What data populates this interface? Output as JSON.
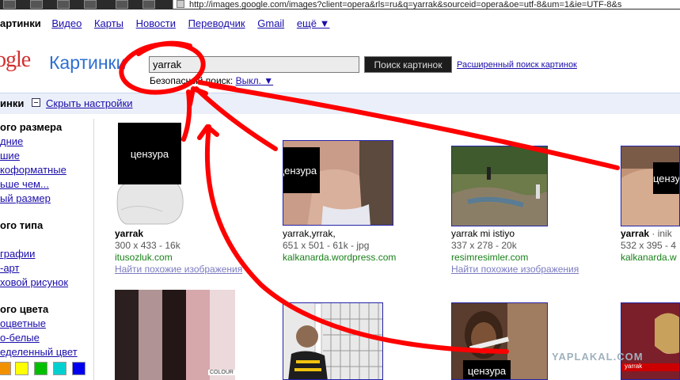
{
  "browser": {
    "url": "http://images.google.com/images?client=opera&rls=ru&q=yarrak&sourceid=opera&oe=utf-8&um=1&ie=UTF-8&s"
  },
  "nav": {
    "current": "артинки",
    "links": [
      "Видео",
      "Карты",
      "Новости",
      "Переводчик",
      "Gmail"
    ],
    "more": "ещё ▼"
  },
  "header": {
    "logo": "ogle",
    "product": "Картинки",
    "search_value": "yarrak",
    "search_button": "Поиск картинок",
    "advanced": "Расширенный поиск картинок",
    "safe_label": "Безопасный поиск:",
    "safe_value": "Выкл. ▼"
  },
  "settings": {
    "label": "инки",
    "hide": "Скрыть настройки"
  },
  "sidebar": {
    "size": {
      "title": "ого размера",
      "items": [
        "дние",
        "шие",
        "коформатные",
        "ьше чем...",
        "ый размер"
      ]
    },
    "type": {
      "title": "ого типа",
      "items": [
        "",
        "графии",
        "-арт",
        "ховой рисунок"
      ]
    },
    "color": {
      "title": "ого цвета",
      "items": [
        "оцветные",
        "о-белые",
        "еделенный цвет"
      ]
    },
    "swatches": [
      "#f29100",
      "#ffff00",
      "#00c000",
      "#00d0d0",
      "#0000ee"
    ]
  },
  "results": [
    {
      "title": "yarrak",
      "meta": "300 x 433 - 16k",
      "host": "itusozluk.com",
      "similar": "Найти похожие изображения",
      "censor": "цензура"
    },
    {
      "title": "yarrak,yrrak,",
      "meta": "651 x 501 - 61k - jpg",
      "host": "kalkanarda.wordpress.com",
      "censor": "цензура"
    },
    {
      "title": "yarrak mi istiyo",
      "meta": "337 x 278 - 20k",
      "host": "resimresimler.com",
      "similar": "Найти похожие изображения"
    },
    {
      "title": "yarrak · inik",
      "meta": "532 x 395 - 4",
      "host": "kalkanarda.w",
      "censor": "цензура"
    }
  ],
  "row2": {
    "censor": "цензура",
    "logo_text": "COLOUR",
    "tv_text": "yarrak",
    "watermark": "YAPLAKAL.COM"
  },
  "colors": {
    "link": "#1a0dab",
    "host": "#188018",
    "annotation": "#ff0000"
  }
}
